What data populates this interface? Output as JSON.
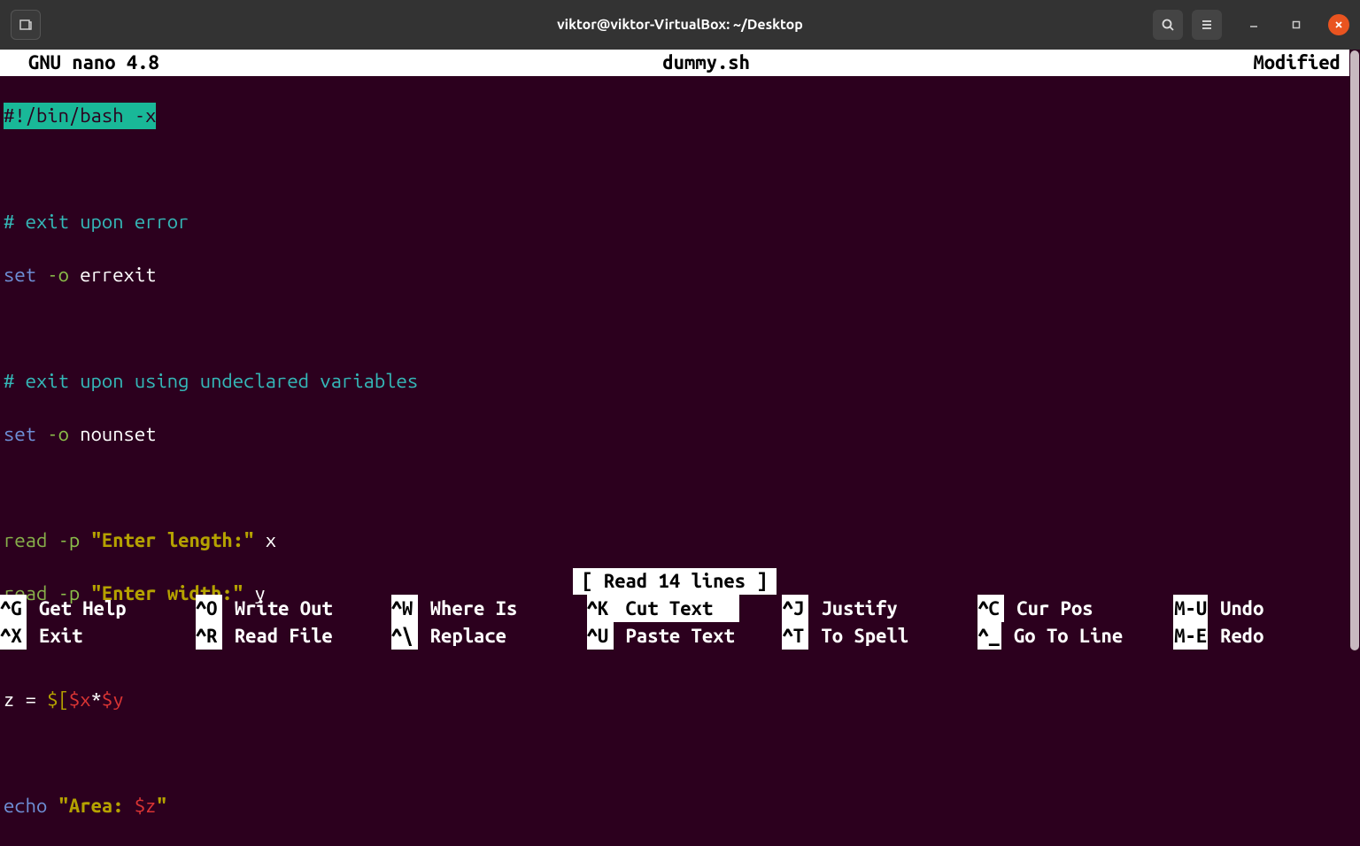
{
  "window": {
    "title": "viktor@viktor-VirtualBox: ~/Desktop"
  },
  "nano": {
    "app_title": "GNU nano 4.8",
    "filename": "dummy.sh",
    "status_right": "Modified",
    "status_message": "[ Read 14 lines ]"
  },
  "code": {
    "shebang": "#!/bin/bash -x",
    "comment1": "# exit upon error",
    "set_kw": "set",
    "set_flag": "-o",
    "set_opt1": "errexit",
    "comment2": "# exit upon using undeclared variables",
    "set_opt2": "nounset",
    "read_cmd": "read",
    "read_flag": "-p",
    "prompt1": "\"Enter length:\"",
    "var1": "x",
    "prompt2": "\"Enter width:\"",
    "var2": "y",
    "assign_lhs": "z = ",
    "assign_dollar": "$[",
    "assign_vx": "$x",
    "assign_star": "*",
    "assign_vy": "$y",
    "echo_cmd": "echo",
    "echo_str_open": "\"Area: ",
    "echo_var": "$z",
    "echo_str_close": "\""
  },
  "shortcuts": {
    "r1c1": {
      "key": "^G",
      "label": "Get Help"
    },
    "r1c2": {
      "key": "^O",
      "label": "Write Out"
    },
    "r1c3": {
      "key": "^W",
      "label": "Where Is"
    },
    "r1c4": {
      "key": "^K",
      "label": "Cut Text"
    },
    "r1c5": {
      "key": "^J",
      "label": "Justify"
    },
    "r1c6": {
      "key": "^C",
      "label": "Cur Pos"
    },
    "r1c7": {
      "key": "M-U",
      "label": "Undo"
    },
    "r2c1": {
      "key": "^X",
      "label": "Exit"
    },
    "r2c2": {
      "key": "^R",
      "label": "Read File"
    },
    "r2c3": {
      "key": "^\\",
      "label": "Replace"
    },
    "r2c4": {
      "key": "^U",
      "label": "Paste Text"
    },
    "r2c5": {
      "key": "^T",
      "label": "To Spell"
    },
    "r2c6": {
      "key": "^_",
      "label": "Go To Line"
    },
    "r2c7": {
      "key": "M-E",
      "label": "Redo"
    }
  }
}
